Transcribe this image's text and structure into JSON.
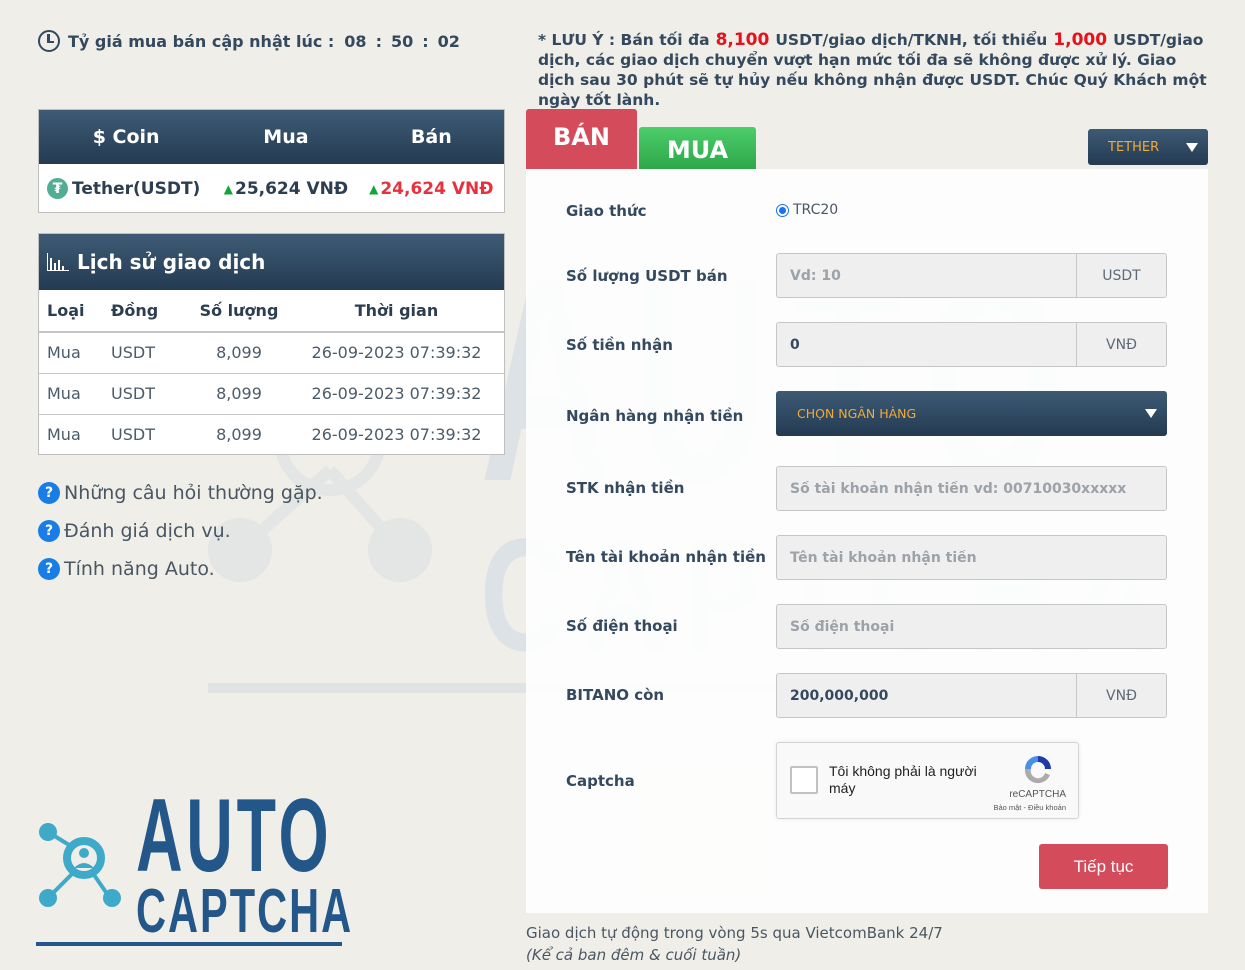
{
  "header": {
    "update_label": "Tỷ giá mua bán cập nhật lúc :",
    "time": {
      "hh": "08",
      "mm": "50",
      "ss": "02"
    },
    "notice": {
      "prefix": "* LƯU Ý : Bán tối đa",
      "max_value": "8,100",
      "middle": "USDT/giao dịch/TKNH, tối thiểu",
      "min_value": "1,000",
      "suffix": "USDT/giao dịch, các giao dịch chuyển vượt hạn mức tối đa sẽ không được xử lý. Giao dịch sau 30 phút sẽ tự hủy nếu không nhận được USDT. Chúc Quý Khách một ngày tốt lành."
    }
  },
  "rates": {
    "columns": [
      "$ Coin",
      "Mua",
      "Bán"
    ],
    "rows": [
      {
        "icon": "tether-icon",
        "coin": "Tether(USDT)",
        "buy": "25,624 VNĐ",
        "sell": "24,624 VNĐ"
      }
    ]
  },
  "history": {
    "title": "Lịch sử giao dịch",
    "columns": [
      "Loại",
      "Đồng",
      "Số lượng",
      "Thời gian"
    ],
    "rows": [
      [
        "Mua",
        "USDT",
        "8,099",
        "26-09-2023 07:39:32"
      ],
      [
        "Mua",
        "USDT",
        "8,099",
        "26-09-2023 07:39:32"
      ],
      [
        "Mua",
        "USDT",
        "8,099",
        "26-09-2023 07:39:32"
      ]
    ]
  },
  "faq": [
    {
      "icon": "question-icon",
      "label": "Những câu hỏi thường gặp."
    },
    {
      "icon": "question-icon",
      "label": "Đánh giá dịch vụ."
    },
    {
      "icon": "question-icon",
      "label": "Tính năng Auto."
    }
  ],
  "logo": {
    "line1": "AUTO",
    "line2": "CAPTCHA"
  },
  "watermark": {
    "line1": "AUTO",
    "line2": "CAPTCHA"
  },
  "tabs": {
    "sell": "BÁN",
    "buy": "MUA",
    "active": "sell"
  },
  "coin_select": {
    "selected": "TETHER"
  },
  "form": {
    "protocol": {
      "label": "Giao thức",
      "option": "TRC20",
      "checked": true
    },
    "amount": {
      "label": "Số lượng USDT bán",
      "placeholder": "Vd: 10",
      "value": "",
      "unit": "USDT"
    },
    "receive": {
      "label": "Số tiền nhận",
      "value": "0",
      "unit": "VNĐ"
    },
    "bank": {
      "label": "Ngân hàng nhận tiền",
      "selected": "CHỌN NGÂN HÀNG"
    },
    "account_no": {
      "label": "STK nhận tiền",
      "placeholder": "Số tài khoản nhận tiền vd: 00710030xxxxx",
      "value": ""
    },
    "account_name": {
      "label": "Tên tài khoản nhận tiền",
      "placeholder": "Tên tài khoản nhận tiền",
      "value": ""
    },
    "phone": {
      "label": "Số điện thoại",
      "placeholder": "Số điện thoại",
      "value": ""
    },
    "balance": {
      "label": "BITANO còn",
      "value": "200,000,000",
      "unit": "VNĐ"
    },
    "captcha": {
      "label": "Captcha",
      "checkbox_text": "Tôi không phải là người máy",
      "brand": "reCAPTCHA",
      "terms": "Bảo mật - Điều khoản",
      "checked": false
    },
    "submit_label": "Tiếp tục"
  },
  "footer": {
    "line1": "Giao dịch tự động trong vòng 5s qua VietcomBank 24/7",
    "line2": "(Kể cả ban đêm & cuối tuần)"
  },
  "colors": {
    "background": "#efeee8",
    "header_navy": "#2d4963",
    "sell_red": "#d44b5c",
    "buy_green": "#3dbb5a",
    "accent_orange": "#f2a93b",
    "notice_red": "#e8101a",
    "logo_blue": "#245789",
    "logo_cyan": "#3fa9c9"
  }
}
